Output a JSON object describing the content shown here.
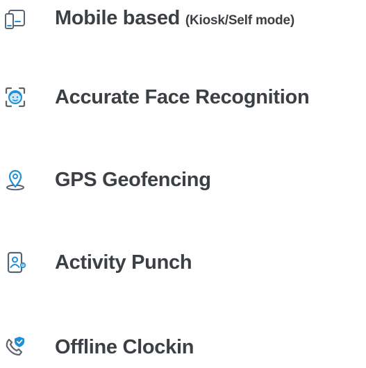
{
  "colors": {
    "text": "#3c4045",
    "icon_stroke": "#5a6470",
    "icon_accent": "#1f8fd6",
    "icon_fill_light": "#cfe6f7"
  },
  "features": [
    {
      "label": "Mobile based",
      "note": "(Kiosk/Self mode)",
      "icon": "mobile-kiosk-icon"
    },
    {
      "label": "Accurate Face Recognition",
      "icon": "face-scan-icon"
    },
    {
      "label": "GPS Geofencing",
      "icon": "location-pin-icon"
    },
    {
      "label": "Activity Punch",
      "icon": "id-card-icon"
    },
    {
      "label": "Offline Clockin",
      "icon": "phone-shield-icon"
    }
  ]
}
